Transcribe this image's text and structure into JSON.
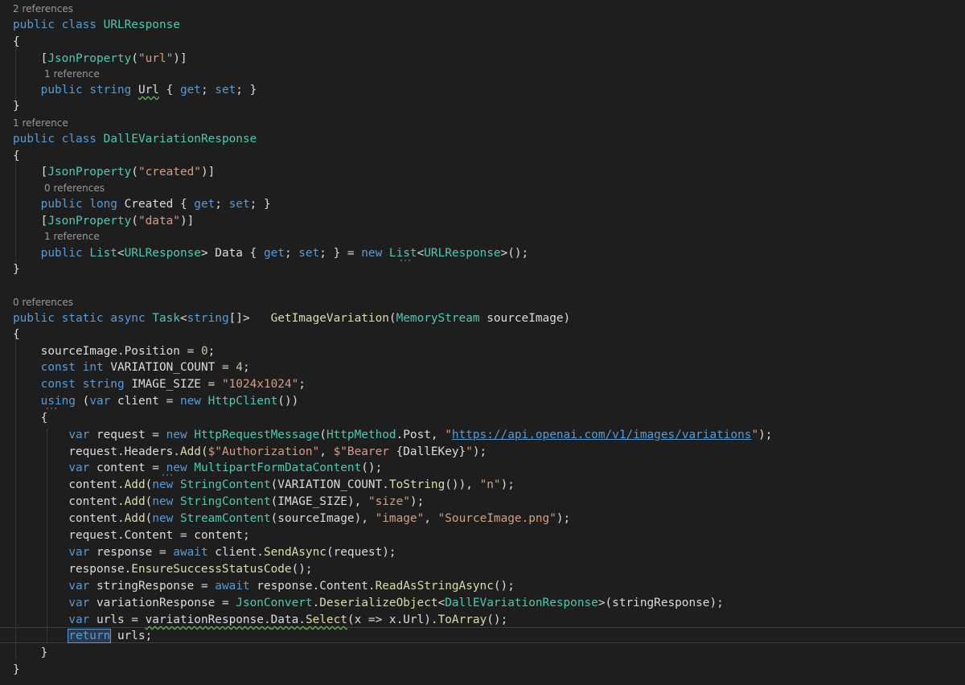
{
  "codelens": {
    "c1": "2 references",
    "c2": "1 reference",
    "c3": "1 reference",
    "c4": "0 references",
    "c5": "1 reference",
    "c6": "0 references"
  },
  "code": {
    "kw_public": "public",
    "kw_class": "class",
    "kw_string": "string",
    "kw_get": "get",
    "kw_set": "set",
    "kw_long": "long",
    "kw_new": "new",
    "kw_static": "static",
    "kw_async": "async",
    "kw_const": "const",
    "kw_int": "int",
    "kw_using": "using",
    "kw_var": "var",
    "kw_await": "await",
    "kw_return": "return",
    "t_urlresponse": "URLResponse",
    "t_dalle": "DallEVariationResponse",
    "t_jsonproperty": "JsonProperty",
    "t_list": "List",
    "t_task": "Task",
    "t_memorystream": "MemoryStream",
    "t_httpclient": "HttpClient",
    "t_httprequestmessage": "HttpRequestMessage",
    "t_httpmethod": "HttpMethod",
    "t_multipart": "MultipartFormDataContent",
    "t_stringcontent": "StringContent",
    "t_streamcontent": "StreamContent",
    "t_jsonconvert": "JsonConvert",
    "s_url": "\"url\"",
    "s_created": "\"created\"",
    "s_data": "\"data\"",
    "s_size": "\"1024x1024\"",
    "s_url_open": "\"",
    "s_url_link": "https://api.openai.com/v1/images/variations",
    "s_url_close": "\"",
    "s_auth": "$\"Authorization\"",
    "s_bearer_a": "$\"Bearer ",
    "s_bearer_var": "{DallEKey}",
    "s_bearer_b": "\"",
    "s_n": "\"n\"",
    "s_sizekey": "\"size\"",
    "s_image": "\"image\"",
    "s_png": "\"SourceImage.png\"",
    "n_zero": "0",
    "n_four": "4",
    "m_getimagevariation": "GetImageVariation",
    "m_add": "Add",
    "m_tostring": "ToString",
    "m_sendasync": "SendAsync",
    "m_ensure": "EnsureSuccessStatusCode",
    "m_readasstring": "ReadAsStringAsync",
    "m_deserialize": "DeserializeObject",
    "m_select": "Select",
    "m_toarray": "ToArray",
    "id_url": "Url",
    "id_created": "Created",
    "id_data": "Data",
    "id_sourceimage": "sourceImage",
    "id_position": "Position",
    "id_variation_count": "VARIATION_COUNT",
    "id_image_size": "IMAGE_SIZE",
    "id_client": "client",
    "id_request": "request",
    "id_post": "Post",
    "id_headers": "Headers",
    "id_content": "content",
    "id_Content": "Content",
    "id_response": "response",
    "id_stringresponse": "stringResponse",
    "id_variationresponse": "variationResponse",
    "id_urls": "urls",
    "id_x": "x"
  }
}
